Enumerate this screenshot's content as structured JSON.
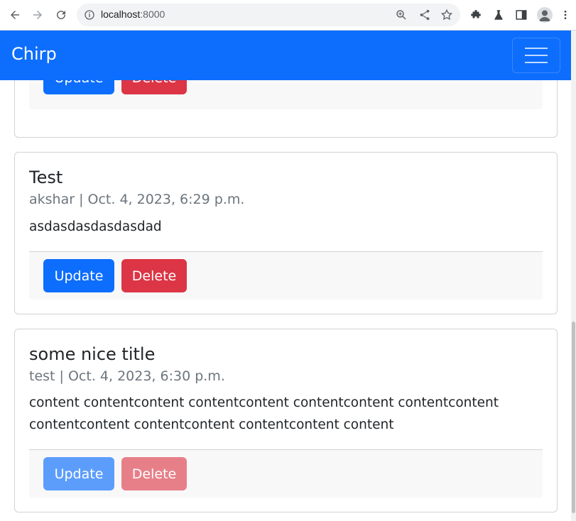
{
  "browser": {
    "url_host": "localhost",
    "url_port": ":8000"
  },
  "navbar": {
    "brand": "Chirp"
  },
  "buttons": {
    "update": "Update",
    "delete": "Delete"
  },
  "posts": [
    {
      "title": "Test",
      "meta": "akshar | Oct. 4, 2023, 6:29 p.m.",
      "content": "asdasdasdasdasdad"
    },
    {
      "title": "some nice title",
      "meta": "test | Oct. 4, 2023, 6:30 p.m.",
      "content": "content contentcontent contentcontent contentcontent contentcontent contentcontent contentcontent contentcontent content"
    }
  ],
  "colors": {
    "primary": "#0d6efd",
    "danger": "#dc3545"
  }
}
